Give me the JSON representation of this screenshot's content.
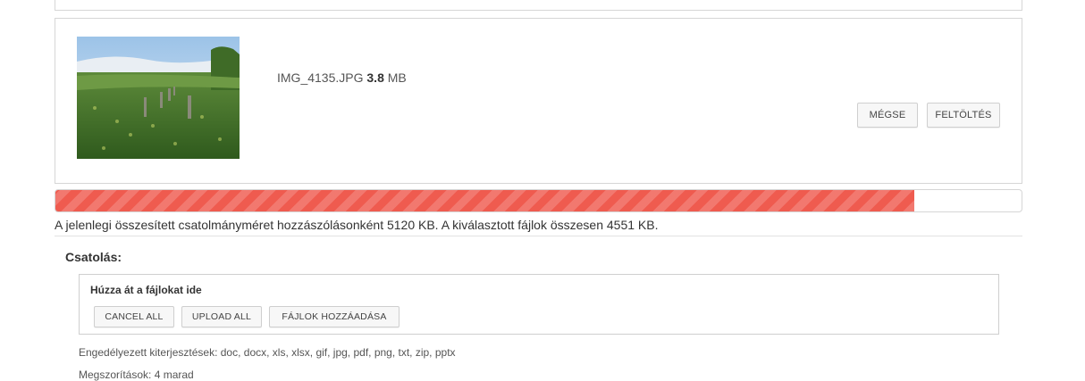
{
  "file": {
    "name": "IMG_4135.JPG",
    "size_value": "3.8",
    "size_unit": "MB",
    "thumbnail_icon": "photo-thumbnail",
    "cancel_label": "MÉGSE",
    "upload_label": "FELTÖLTÉS"
  },
  "progress": {
    "fraction": 0.889,
    "color": "#ef5b4f"
  },
  "summary_text": "A jelenlegi összesített csatolmányméret hozzászólásonként 5120 KB. A kiválasztott fájlok összesen 4551 KB.",
  "attach": {
    "label": "Csatolás:",
    "drop_title": "Húzza át a fájlokat ide",
    "buttons": {
      "cancel_all": "CANCEL ALL",
      "upload_all": "UPLOAD ALL",
      "add_files": "FÁJLOK HOZZÁADÁSA"
    },
    "allowed_extensions": "Engedélyezett kiterjesztések: doc, docx, xls, xlsx, gif, jpg, pdf, png, txt, zip, pptx",
    "limits": "Megszorítások: 4 marad"
  }
}
